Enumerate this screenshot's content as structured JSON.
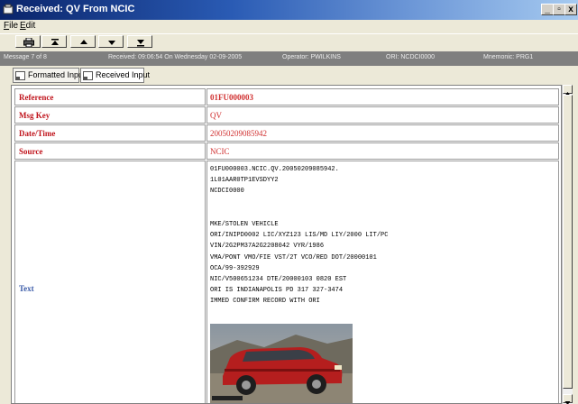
{
  "window": {
    "title": "Received: QV From NCIC"
  },
  "window_buttons": {
    "minimize": "_",
    "maximize": "▫",
    "close": "x"
  },
  "menu": [
    {
      "label": "File"
    },
    {
      "label": "Edit"
    }
  ],
  "toolbar": [
    {
      "icon": "print-icon"
    },
    {
      "icon": "first-icon"
    },
    {
      "icon": "previous-icon"
    },
    {
      "icon": "next-icon"
    },
    {
      "icon": "last-icon"
    }
  ],
  "status": {
    "message": "Message 7 of 8",
    "received": "Received: 09:06:54 On Wednesday 02-09-2005",
    "operator": "Operator: PWILKINS",
    "ori": "ORI: NCDCI0000",
    "mnemonic": "Mnemonic: PRG1"
  },
  "tabs": [
    {
      "label": "Formatted Input",
      "active": true
    },
    {
      "label": "Received Input",
      "active": false
    }
  ],
  "record": {
    "reference_label": "Reference",
    "reference_value": "01FU000003",
    "msgkey_label": "Msg Key",
    "msgkey_value": "QV",
    "datetime_label": "Date/Time",
    "datetime_value": "20050209085942",
    "source_label": "Source",
    "source_value": "NCIC",
    "text_label": "Text",
    "text_lines": [
      "01FU000003.NCIC.QV.20050209085942.",
      "1L01AAR0TP1EVSDYY2",
      "NCDCI0000",
      "",
      "",
      "MKE/STOLEN VEHICLE",
      "ORI/INIPD0002 LIC/XYZ123 LIS/MD LIY/2000 LIT/PC",
      "VIN/2G2PM37A2G2208042 VYR/1986",
      "VMA/PONT VMO/FIE VST/2T VCO/RED DOT/20000101",
      "OCA/99-392929",
      "NIC/V500651234 DTE/20000103 0820 EST",
      "ORI IS INDIANAPOLIS PD 317 327-3474",
      "IMMED CONFIRM RECORD WITH ORI"
    ]
  },
  "colors": {
    "label_red": "#c0141c",
    "value_red": "#d03030",
    "text_label_blue": "#3a5aa8",
    "status_bar": "#7f7f7f"
  }
}
